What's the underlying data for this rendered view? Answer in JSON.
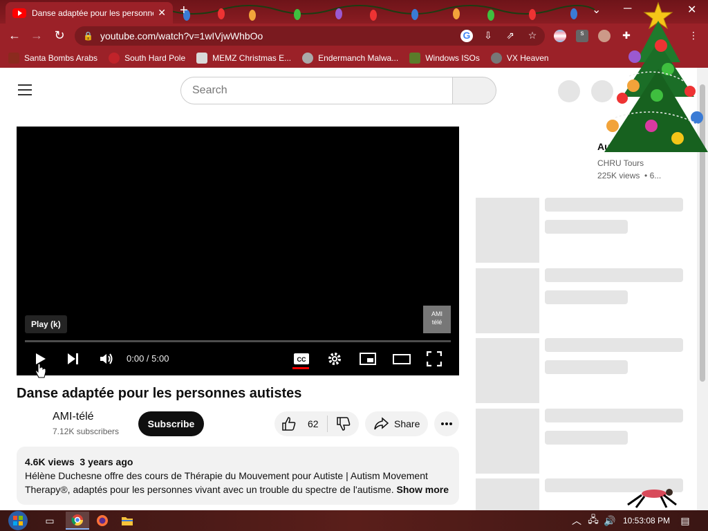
{
  "browser": {
    "tab_title": "Danse adaptée pour les personnes autistes",
    "tab_close": "✕",
    "new_tab": "+",
    "url": "youtube.com/watch?v=1wIVjwWhbOo",
    "window_controls": {
      "dropdown": "⌄",
      "minimize": "─",
      "close": "✕"
    },
    "nav": {
      "back": "←",
      "forward": "→",
      "reload": "↻"
    }
  },
  "bookmarks": [
    {
      "label": "Santa Bombs Arabs",
      "color": "#8b2a1e"
    },
    {
      "label": "South Hard Pole",
      "color": "#c0232a"
    },
    {
      "label": "MEMZ Christmas E...",
      "color": "#d9d9d9"
    },
    {
      "label": "Endermanch Malwa...",
      "color": "#aaaaaa"
    },
    {
      "label": "Windows ISOs",
      "color": "#5a7b2a"
    },
    {
      "label": "VX Heaven",
      "color": "#777777"
    }
  ],
  "youtube": {
    "search_placeholder": "Search",
    "player": {
      "tooltip": "Play (k)",
      "time": "0:00 / 5:00",
      "watermark_top": "AMI",
      "watermark_bottom": "télé",
      "progress": 0.0
    },
    "video": {
      "title": "Danse adaptée pour les personnes autistes",
      "channel": "AMI-télé",
      "subscribers": "7.12K subscribers",
      "subscribe_label": "Subscribe",
      "likes": "62",
      "share_label": "Share",
      "views": "4.6K views",
      "age": "3 years ago",
      "description": "Hélène Duchesne offre des cours de Thérapie du Mouvement pour Autiste | Autism Movement Therapy®,  adaptés pour les personnes vivant avec un trouble du spectre de l'autisme.",
      "show_more": "Show more"
    },
    "sidebar": {
      "partial_title": "Au... Therapie...",
      "channel": "CHRU Tours",
      "views": "225K views",
      "age": "• 6..."
    }
  },
  "taskbar": {
    "clock": "10:53:08 PM"
  }
}
